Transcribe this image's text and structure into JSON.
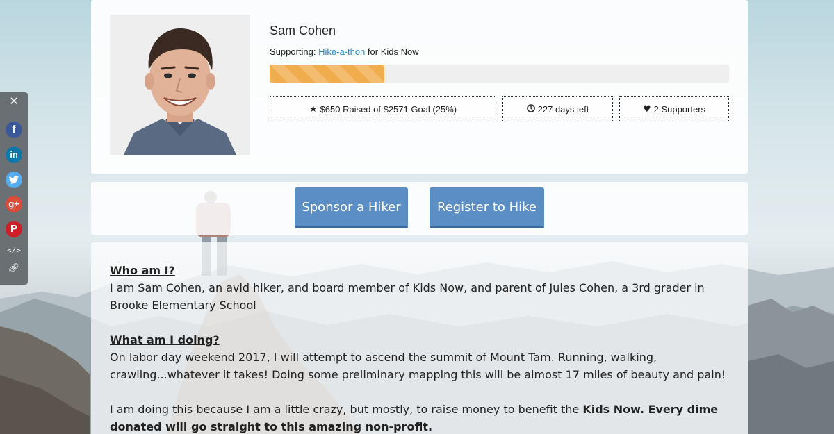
{
  "profile": {
    "name": "Sam Cohen",
    "supporting_prefix": "Supporting: ",
    "event_link": "Hike-a-thon",
    "supporting_suffix": " for Kids Now",
    "progress_fraction": 0.25,
    "raised_text": "$650 Raised of $2571 Goal (25%)",
    "days_text": "227 days left",
    "supporters_text": "2 Supporters",
    "icons": {
      "raised": "star-icon",
      "days": "clock-icon",
      "supporters": "heart-icon"
    }
  },
  "actions": {
    "sponsor_label": "Sponsor a Hiker",
    "register_label": "Register to Hike"
  },
  "share": {
    "items": [
      "close-icon",
      "facebook-icon",
      "linkedin-icon",
      "twitter-icon",
      "google-plus-icon",
      "pinterest-icon",
      "embed-code-icon",
      "link-icon"
    ]
  },
  "story": {
    "heading1": "Who am I?",
    "para1": "I am Sam Cohen, an avid hiker, and board member of Kids Now, and parent of Jules Cohen, a 3rd grader in Brooke Elementary School",
    "heading2": "What am I doing?",
    "para2": "On labor day weekend 2017, I will attempt to ascend the summit of Mount Tam. Running, walking, crawling...whatever it takes! Doing some preliminary mapping this will be almost 17 miles of beauty and pain!",
    "para3_plain": "I am doing this because I am a little crazy, but mostly, to raise money to benefit the ",
    "para3_bold": "Kids Now. Every dime donated will go straight to this amazing non-profit."
  },
  "colors": {
    "button_blue": "#5b8ec4",
    "progress_orange": "#f0ad4e",
    "link_blue": "#2a8cc4"
  }
}
